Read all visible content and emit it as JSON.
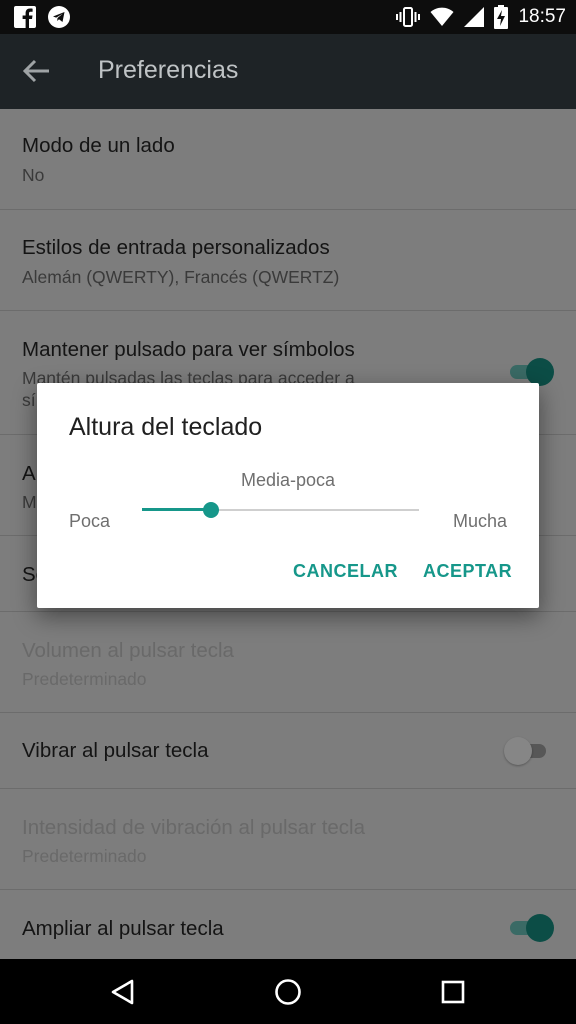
{
  "status_bar": {
    "time": "18:57"
  },
  "app_bar": {
    "title": "Preferencias"
  },
  "settings": [
    {
      "title": "Modo de un lado",
      "summary": "No"
    },
    {
      "title": "Estilos de entrada personalizados",
      "summary": "Alemán (QWERTY), Francés (QWERTZ)"
    },
    {
      "title": "Mantener pulsado para ver símbolos",
      "summary_line1": "Mantén pulsadas las teclas para acceder a",
      "summary_line2": "sí",
      "toggle": "on"
    },
    {
      "title": "A",
      "summary": "M"
    },
    {
      "title": "Se"
    },
    {
      "title": "Volumen al pulsar tecla",
      "summary": "Predeterminado",
      "disabled": true
    },
    {
      "title": "Vibrar al pulsar tecla",
      "toggle": "off"
    },
    {
      "title": "Intensidad de vibración al pulsar tecla",
      "summary": "Predeterminado",
      "disabled": true
    },
    {
      "title": "Ampliar al pulsar tecla",
      "toggle": "on"
    }
  ],
  "dialog": {
    "title": "Altura del teclado",
    "value_label": "Media-poca",
    "min_label": "Poca",
    "max_label": "Mucha",
    "slider_fraction": 0.25,
    "cancel_label": "CANCELAR",
    "ok_label": "ACEPTAR"
  },
  "colors": {
    "accent": "#16978a",
    "toggle_on": "#0c4d46",
    "app_bar": "#1e2326"
  },
  "icons": {
    "status_left": [
      "facebook-icon",
      "telegram-icon"
    ],
    "status_right": [
      "vibrate-icon",
      "wifi-icon",
      "signal-icon",
      "battery-charging-icon"
    ],
    "app_bar": "back-arrow-icon",
    "nav": [
      "nav-back-icon",
      "nav-home-icon",
      "nav-recents-icon"
    ]
  }
}
